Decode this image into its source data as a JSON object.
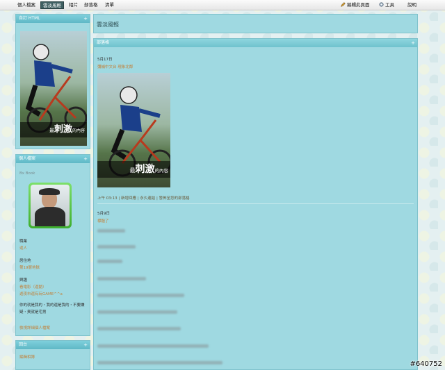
{
  "nav": {
    "items": [
      "個人檔案",
      "雲淡風輕",
      "相片",
      "部落格",
      "清單"
    ],
    "active_index": 1,
    "edit_page": "編輯此頁面",
    "tools": "工具",
    "help": "說明"
  },
  "left": {
    "html_panel": {
      "title": "自訂 HTML",
      "caption_big": "刺激",
      "caption_prefix": "最",
      "caption_suffix": "的內容"
    },
    "profile_panel": {
      "title": "個人檔案",
      "name": "Bx Book",
      "occupation_label": "職業",
      "occupation_value": "達人",
      "residence_label": "居住地",
      "residence_value": "第19層地獄",
      "interests_label": "興趣",
      "interests_value_1": "看電影（逼動）",
      "interests_value_2": "遊夜市還有玩GAME^^a",
      "quote": "你的就是我的・我的還是我的・不要嫌疑・奧就是宅男",
      "more_link": "檢視詳細個人檔案"
    },
    "list_panel": {
      "title": "回台",
      "link": "編輯相簿"
    }
  },
  "main": {
    "title": "雲淡風輕",
    "blog_title": "部落格",
    "post1": {
      "date": "5月17日",
      "subject": "彌補中文台 現象北鄰",
      "caption_big": "刺激",
      "caption_prefix": "最",
      "caption_suffix": "的內容",
      "footer": "上午 03:13 | 新增回應 | 永久連結 | 發佈至您的部落格"
    },
    "post2": {
      "date": "5月9日",
      "subject": "標題了"
    }
  },
  "watermark": "#640752",
  "colors": {
    "panel": "#9fd9e1",
    "panel_head": "#5fb8c6",
    "link": "#c2813a",
    "nav_active": "#3f5f62"
  }
}
